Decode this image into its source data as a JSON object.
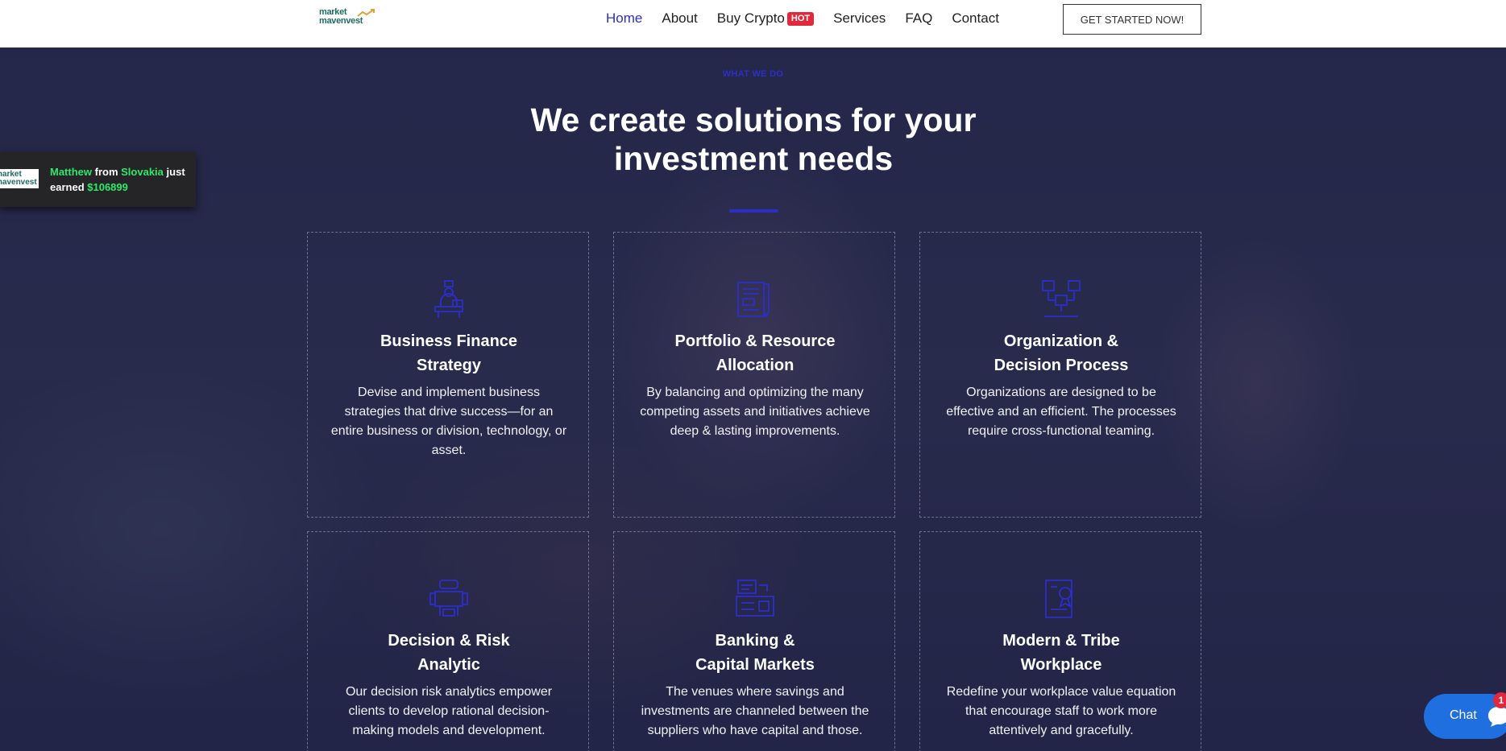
{
  "header": {
    "logo_line1": "market",
    "logo_line2": "mavenvest",
    "nav": [
      {
        "label": "Home"
      },
      {
        "label": "About"
      },
      {
        "label": "Buy Crypto",
        "badge": "HOT"
      },
      {
        "label": "Services"
      },
      {
        "label": "FAQ"
      },
      {
        "label": "Contact"
      }
    ],
    "cta_label": "GET STARTED NOW!"
  },
  "section": {
    "eyebrow": "WHAT WE DO",
    "title": "We create solutions for your investment needs"
  },
  "cards": [
    {
      "icon": "presenter-desk-icon",
      "title_line1": "Business Finance",
      "title_line2": "Strategy",
      "desc": "Devise and implement business strategies that drive success—for an entire business or division, technology, or asset."
    },
    {
      "icon": "document-pen-icon",
      "title_line1": "Portfolio & Resource",
      "title_line2": "Allocation",
      "desc": "By balancing and optimizing the many competing assets and initiatives achieve deep & lasting improvements."
    },
    {
      "icon": "org-chart-icon",
      "title_line1": "Organization &",
      "title_line2": "Decision Process",
      "desc": "Organizations are designed to be effective and an efficient. The processes require cross-functional teaming."
    },
    {
      "icon": "meeting-table-icon",
      "title_line1": "Decision & Risk",
      "title_line2": "Analytic",
      "desc": "Our decision risk analytics empower clients to develop rational decision-making models and development."
    },
    {
      "icon": "banking-screen-icon",
      "title_line1": "Banking &",
      "title_line2": "Capital Markets",
      "desc": "The venues where savings and investments are channeled between the suppliers who have capital and those."
    },
    {
      "icon": "certificate-icon",
      "title_line1": "Modern & Tribe",
      "title_line2": "Workplace",
      "desc": "Redefine your workplace value equation that encourage staff to work more attentively and gracefully."
    }
  ],
  "toast": {
    "logo_text": "market mavenvest",
    "name": "Matthew",
    "from": "from",
    "country": "Slovakia",
    "just": "just",
    "earned": "earned",
    "amount": "$106899"
  },
  "chat": {
    "label": "Chat",
    "badge": "1"
  },
  "colors": {
    "accent": "#2d2ec8",
    "hot": "#e0293c",
    "toast_green": "#2ee86a",
    "chat_blue": "#1f6fe0"
  }
}
